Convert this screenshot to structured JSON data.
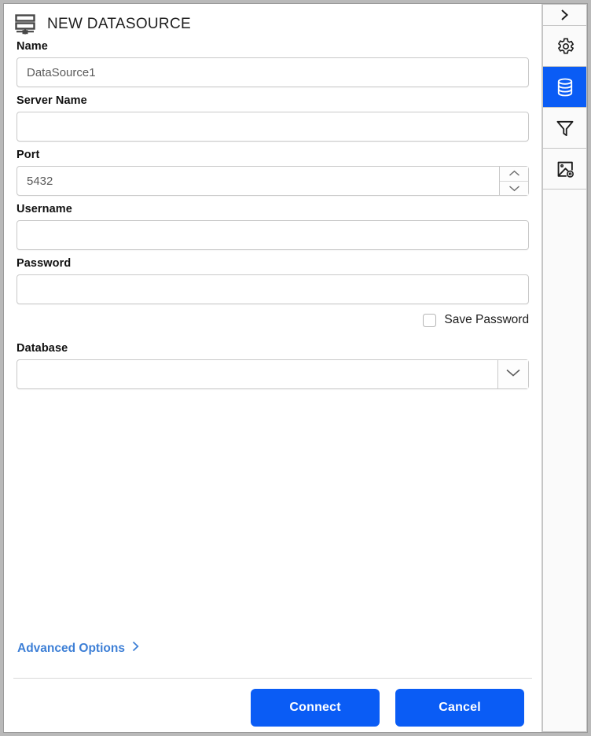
{
  "window": {
    "title": "NEW DATASOURCE",
    "title_icon": "datasource-stack-icon"
  },
  "form": {
    "fields": [
      {
        "label": "Name",
        "value": "DataSource1",
        "placeholder": ""
      },
      {
        "label": "Server Name",
        "value": "",
        "placeholder": ""
      },
      {
        "label": "Port",
        "value": "5432",
        "placeholder": ""
      },
      {
        "label": "Username",
        "value": "",
        "placeholder": ""
      },
      {
        "label": "Password",
        "value": "",
        "placeholder": ""
      },
      {
        "label": "Database",
        "value": "",
        "placeholder": ""
      }
    ],
    "save_password": {
      "label": "Save Password",
      "checked": false
    },
    "advanced_options": {
      "label": "Advanced Options",
      "chevron": "chevron-right-icon"
    }
  },
  "footer": {
    "connect_label": "Connect",
    "cancel_label": "Cancel"
  },
  "rail": {
    "tabs": [
      {
        "name": "expand-panel",
        "icon": "chevron-right-icon",
        "active": false
      },
      {
        "name": "settings",
        "icon": "gear-icon",
        "active": false
      },
      {
        "name": "datasource",
        "icon": "database-icon",
        "active": true
      },
      {
        "name": "filters",
        "icon": "funnel-icon",
        "active": false
      },
      {
        "name": "image-settings",
        "icon": "image-gear-icon",
        "active": false
      }
    ]
  },
  "colors": {
    "accent_blue": "#0a5cf5",
    "link_blue": "#3d7fd6",
    "border_gray": "#c9c9c9",
    "rail_gray": "#c4c4c4"
  }
}
